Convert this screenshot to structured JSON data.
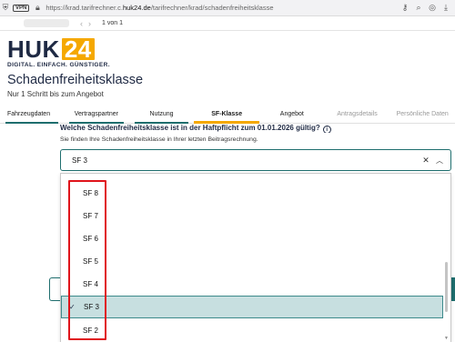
{
  "browser": {
    "vpn_label": "VPN",
    "url_prefix": "https://krad.tarifrechner.c.",
    "url_domain": "huk24.de",
    "url_path": "/tarifrechner/krad/schadenfreiheitsklasse"
  },
  "pdf_toolbar": {
    "page_info": "1 von 1"
  },
  "logo": {
    "brand": "HUK",
    "brand_num": "24",
    "tagline": "DIGITAL. EINFACH. GÜNSTIGER.",
    "accent_color": "#f5a800",
    "brand_color": "#1f2a44"
  },
  "page": {
    "title": "Schadenfreiheitsklasse",
    "subtitle": "Nur 1 Schritt bis zum Angebot"
  },
  "steps": [
    {
      "label": "Fahrzeugdaten"
    },
    {
      "label": "Vertragspartner"
    },
    {
      "label": "Nutzung"
    },
    {
      "label": "SF-Klasse"
    },
    {
      "label": "Angebot"
    },
    {
      "label": "Antragsdetails"
    },
    {
      "label": "Persönliche Daten"
    }
  ],
  "form": {
    "question": "Welche Schadenfreiheitsklasse ist in der Haftpflicht zum 01.01.2026 gültig?",
    "hint": "Sie finden Ihre Schadenfreiheitsklasse in Ihrer letzten Beitragsrechnung.",
    "select_value": "SF 3",
    "options": [
      "SF 8",
      "SF 7",
      "SF 6",
      "SF 5",
      "SF 4",
      "SF 3",
      "SF 2"
    ],
    "selected_option": "SF 3",
    "accent_color": "#1e6e6e",
    "highlight_color": "#e0141b"
  }
}
